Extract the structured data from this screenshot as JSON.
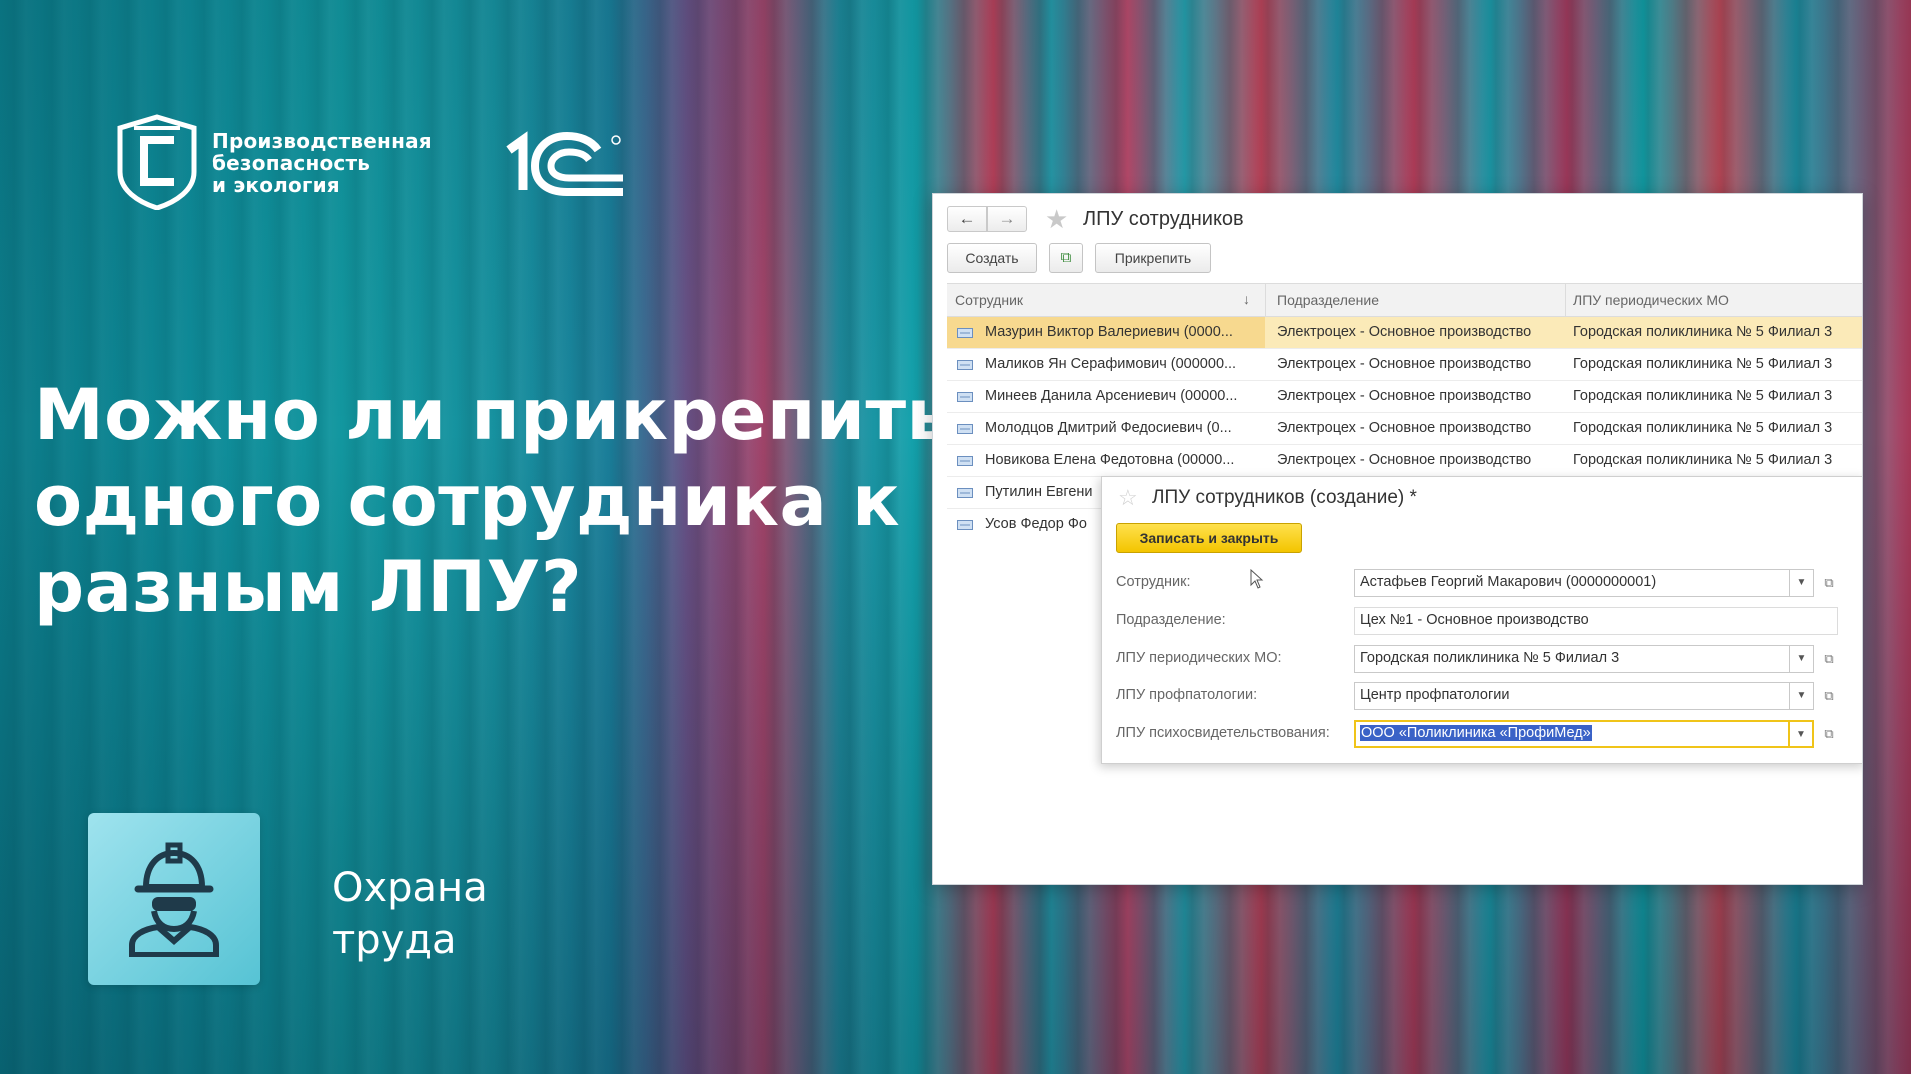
{
  "brand": {
    "logo_lines": [
      "Производственная",
      "безопасность",
      "и экология"
    ],
    "partner_logo": "1С"
  },
  "headline": {
    "lines": [
      "Можно ли прикрепить",
      "одного сотрудника к",
      "разным ЛПУ?"
    ]
  },
  "topic": {
    "icon": "worker-helmet-icon",
    "lines": [
      "Охрана",
      "труда"
    ]
  },
  "window": {
    "title": "ЛПУ сотрудников",
    "nav": {
      "back": "←",
      "forward": "→"
    },
    "toolbar": {
      "create": "Создать",
      "copy_icon": "copy-icon",
      "attach": "Прикрепить"
    },
    "columns": [
      "Сотрудник",
      "Подразделение",
      "ЛПУ периодических МО"
    ],
    "sort_indicator": "↓",
    "rows": [
      {
        "employee": "Мазурин Виктор Валериевич (0000...",
        "department": "Электроцех - Основное производство",
        "lpu": "Городская поликлиника № 5 Филиал 3",
        "selected": true
      },
      {
        "employee": "Маликов Ян Серафимович (000000...",
        "department": "Электроцех - Основное производство",
        "lpu": "Городская поликлиника № 5 Филиал 3"
      },
      {
        "employee": "Минеев Данила Арсениевич (00000...",
        "department": "Электроцех - Основное производство",
        "lpu": "Городская поликлиника № 5 Филиал 3"
      },
      {
        "employee": "Молодцов Дмитрий Федосиевич (0...",
        "department": "Электроцех - Основное производство",
        "lpu": "Городская поликлиника № 5 Филиал 3"
      },
      {
        "employee": "Новикова Елена Федотовна (00000...",
        "department": "Электроцех - Основное производство",
        "lpu": "Городская поликлиника № 5 Филиал 3"
      },
      {
        "employee": "Путилин Евгени",
        "department": "",
        "lpu": ""
      },
      {
        "employee": "Усов Федор Фо",
        "department": "",
        "lpu": ""
      }
    ]
  },
  "dialog": {
    "title": "ЛПУ сотрудников (создание) *",
    "save_close": "Записать и закрыть",
    "fields": [
      {
        "label": "Сотрудник:",
        "value": "Астафьев Георгий Макарович (0000000001)",
        "dropdown": true
      },
      {
        "label": "Подразделение:",
        "value": "Цех №1 - Основное производство",
        "dropdown": false
      },
      {
        "label": "ЛПУ периодических МО:",
        "value": "Городская поликлиника № 5 Филиал 3",
        "dropdown": true
      },
      {
        "label": "ЛПУ профпатологии:",
        "value": "Центр профпатологии",
        "dropdown": true
      },
      {
        "label": "ЛПУ психосвидетельствования:",
        "value": "ООО «Поликлиника «ПрофиМед»",
        "dropdown": true,
        "active": true
      }
    ]
  },
  "colors": {
    "save_button": "#f3c500",
    "selected_row": "#fbeab8",
    "selection_highlight": "#3a62c7",
    "active_field_border": "#f0c419"
  }
}
